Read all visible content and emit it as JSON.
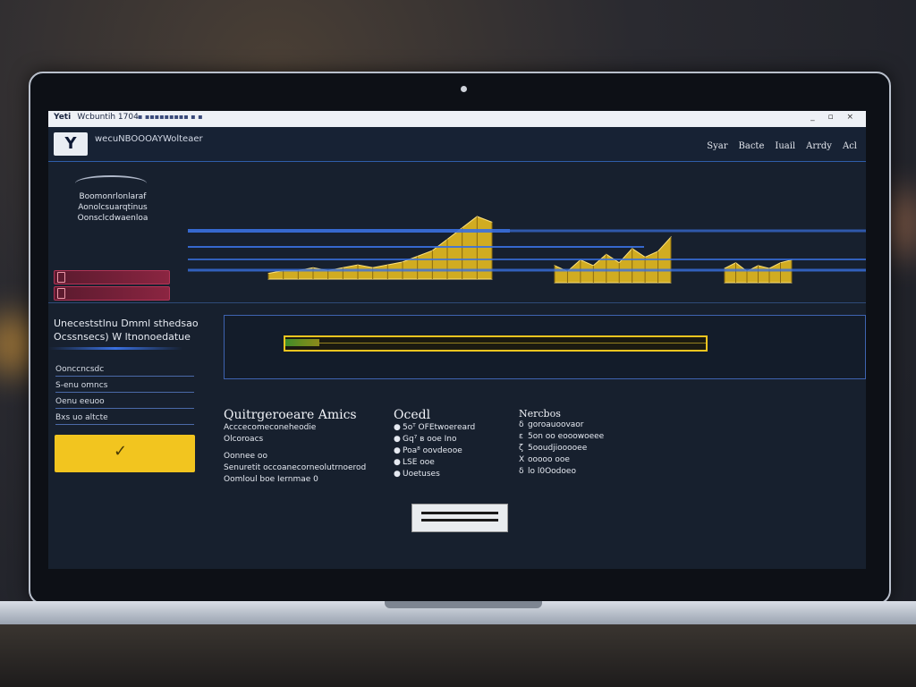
{
  "browser": {
    "tab_title": "Yeti",
    "tab_subtitle": "Wcbuntih 1704",
    "tab_icons": "▪ ▪▪▪▪▪▪▪▪▪ ▪ ▪",
    "window_controls": "_ ▫ ×"
  },
  "app": {
    "logo_text": "Y",
    "title": "wecuNBOOOAYWolteaer",
    "nav": [
      "Syar",
      "Bacte",
      "Iuail",
      "Arrdy",
      "Acl"
    ]
  },
  "sidebar": {
    "brand_lines": [
      "Boomonrlonlaraf",
      "Aonolcsuarqtinus",
      "Oonsclcdwaenloa"
    ],
    "red_buttons": [
      "",
      ""
    ]
  },
  "chart_data": {
    "type": "area",
    "series": [
      {
        "values": [
          2,
          3,
          3,
          4,
          3,
          4,
          5,
          4,
          5,
          6,
          8,
          10,
          14,
          18,
          22,
          20
        ]
      },
      {
        "values": [
          6,
          4,
          8,
          6,
          10,
          7,
          12,
          9,
          11,
          16
        ]
      },
      {
        "values": [
          5,
          7,
          4,
          6,
          5,
          7,
          8
        ]
      }
    ],
    "colors": [
      "#f2c51f",
      "#3a70e0"
    ],
    "grid": false
  },
  "left_form": {
    "title_line1": "Uneceststlnu Dmml sthedsao",
    "title_line2": "Ocssnsecs) W ltnonoedatue",
    "rows": [
      "Oonccncsdc",
      "S-enu omncs",
      "Oenu eeuoo",
      "Bxs uo altcte"
    ],
    "confirm_icon": "✓"
  },
  "progress": {
    "value": 0.08
  },
  "columns": [
    {
      "heading": "Quitrgeroeare Amics",
      "lines": [
        "Acccecomeconeheodie",
        "Olcoroacs",
        "",
        "Oonnee oo",
        "Senuretit occoanecorneolutrnoerod",
        "Oomloul boe Iernmae  0"
      ]
    },
    {
      "heading": "Ocedl",
      "bullets": [
        "●",
        "●",
        "●",
        "●",
        "●"
      ],
      "lines": [
        "5oᵀ OFEtwoereard",
        "Gq⁷ ʙ ooe Ino",
        "Poa⁸ oovdeooe",
        "LSE ooe",
        "Uoetuses"
      ]
    },
    {
      "heading": "Nercbos",
      "bullets": [
        "δ",
        "ε",
        "ζ",
        "X",
        "δ"
      ],
      "lines": [
        "goroauoovaor",
        "5on oo eooowoeee",
        "5ooudjiooooee",
        "ooooo ooe",
        "lo  l0Oodoeo"
      ]
    }
  ]
}
